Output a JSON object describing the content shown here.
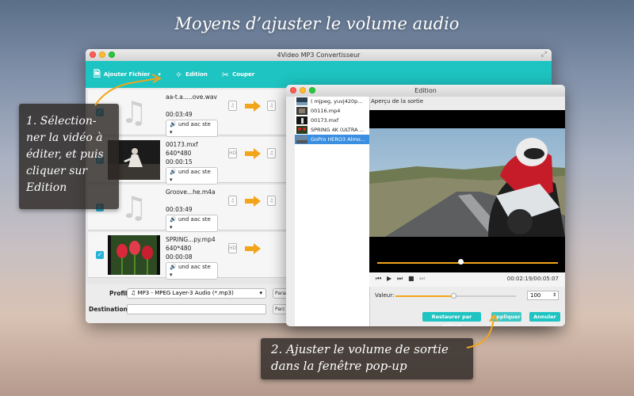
{
  "promo": {
    "title": "Moyens d’ajuster le volume audio",
    "callout_1": "1. Sélection-ner la vidéo à éditer, et puis cliquer sur Edition",
    "callout_2": "2. Ajuster le volume de sortie dans la fenêtre pop-up"
  },
  "main_window": {
    "title": "4Video MP3 Convertisseur",
    "toolbar": {
      "add_file": "Ajouter Fichier",
      "edit": "Edition",
      "cut": "Couper"
    },
    "files": [
      {
        "name": "aa-t.a.....ove.wav",
        "resolution": "",
        "duration": "00:03:49",
        "audio": "und aac ste",
        "thumb": "music"
      },
      {
        "name": "00173.mxf",
        "resolution": "640*480",
        "duration": "00:00:15",
        "audio": "und aac ste",
        "thumb": "video-dance"
      },
      {
        "name": "Groove...he.m4a",
        "resolution": "",
        "duration": "00:03:49",
        "audio": "und aac ste",
        "thumb": "music"
      },
      {
        "name": "SPRING...py.mp4",
        "resolution": "640*480",
        "duration": "00:00:08",
        "audio": "und aac ste",
        "thumb": "video-tulips"
      }
    ],
    "profile_label": "Profil:",
    "profile_value": "MP3 - MPEG Layer-3 Audio (*.mp3)",
    "destination_label": "Destination:",
    "destination_value": "",
    "side_button_1": "Parar",
    "side_button_2": "Parc"
  },
  "edit_dialog": {
    "title": "Edition",
    "files": [
      {
        "name": "( mjpeg, yuvj420p...",
        "selected": false
      },
      {
        "name": "00116.mp4",
        "selected": false
      },
      {
        "name": "00173.mxf",
        "selected": false
      },
      {
        "name": "SPRING 4K (ULTRA ...",
        "selected": false
      },
      {
        "name": "GoPro HERO3 Almo...",
        "selected": true
      }
    ],
    "preview_label": "Aperçu de la sortie",
    "time": "00:02:19/00:05:07",
    "playback_progress": 0.46,
    "volume_label": "Valeur:",
    "volume_value": "100",
    "volume_level": 0.48,
    "restore_button": "Restaurer par défaut",
    "apply_button": "Appliquer",
    "cancel_button": "Annuler"
  },
  "colors": {
    "accent": "#1dc4c1",
    "orange": "#f2a51a",
    "selection": "#3b8fe0"
  }
}
